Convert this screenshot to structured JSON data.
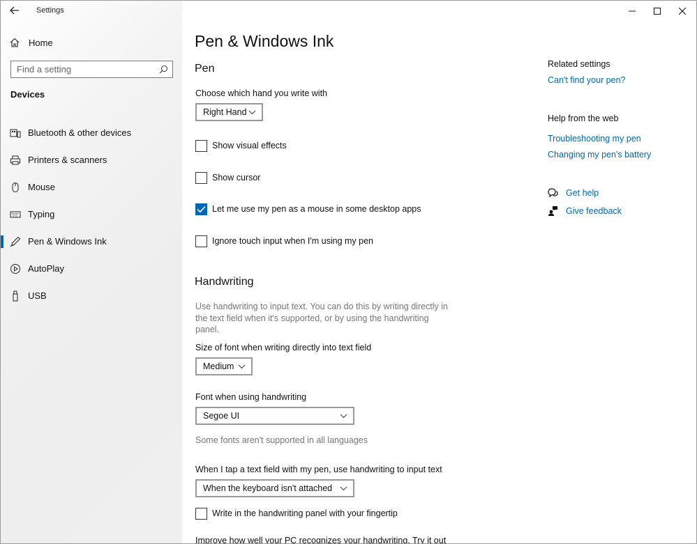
{
  "window": {
    "title": "Settings"
  },
  "sidebar": {
    "home_label": "Home",
    "search_placeholder": "Find a setting",
    "section": "Devices",
    "items": [
      {
        "label": "Bluetooth & other devices",
        "icon": "bluetooth-devices-icon"
      },
      {
        "label": "Printers & scanners",
        "icon": "printer-icon"
      },
      {
        "label": "Mouse",
        "icon": "mouse-icon"
      },
      {
        "label": "Typing",
        "icon": "keyboard-icon"
      },
      {
        "label": "Pen & Windows Ink",
        "icon": "pen-icon",
        "active": true
      },
      {
        "label": "AutoPlay",
        "icon": "autoplay-icon"
      },
      {
        "label": "USB",
        "icon": "usb-icon"
      }
    ]
  },
  "main": {
    "title": "Pen & Windows Ink",
    "pen": {
      "heading": "Pen",
      "hand_label": "Choose which hand you write with",
      "hand_value": "Right Hand",
      "checkboxes": [
        {
          "label": "Show visual effects",
          "checked": false
        },
        {
          "label": "Show cursor",
          "checked": false
        },
        {
          "label": "Let me use my pen as a mouse in some desktop apps",
          "checked": true
        },
        {
          "label": "Ignore touch input when I'm using my pen",
          "checked": false
        }
      ]
    },
    "handwriting": {
      "heading": "Handwriting",
      "description": "Use handwriting to input text. You can do this by writing directly in the text field when it's supported, or by using the handwriting panel.",
      "font_size_label": "Size of font when writing directly into text field",
      "font_size_value": "Medium",
      "font_label": "Font when using handwriting",
      "font_value": "Segoe UI",
      "font_note": "Some fonts aren't supported in all languages",
      "tap_label": "When I tap a text field with my pen, use handwriting to input text",
      "tap_value": "When the keyboard isn't attached",
      "fingertip_label": "Write in the handwriting panel with your fingertip",
      "fingertip_checked": false,
      "improve_text": "Improve how well your PC recognizes your handwriting. Try it out"
    }
  },
  "related": {
    "heading": "Related settings",
    "link1": "Can't find your pen?",
    "help_heading": "Help from the web",
    "link2": "Troubleshooting my pen",
    "link3": "Changing my pen's battery",
    "get_help": "Get help",
    "give_feedback": "Give feedback"
  },
  "colors": {
    "accent": "#0067b8"
  }
}
